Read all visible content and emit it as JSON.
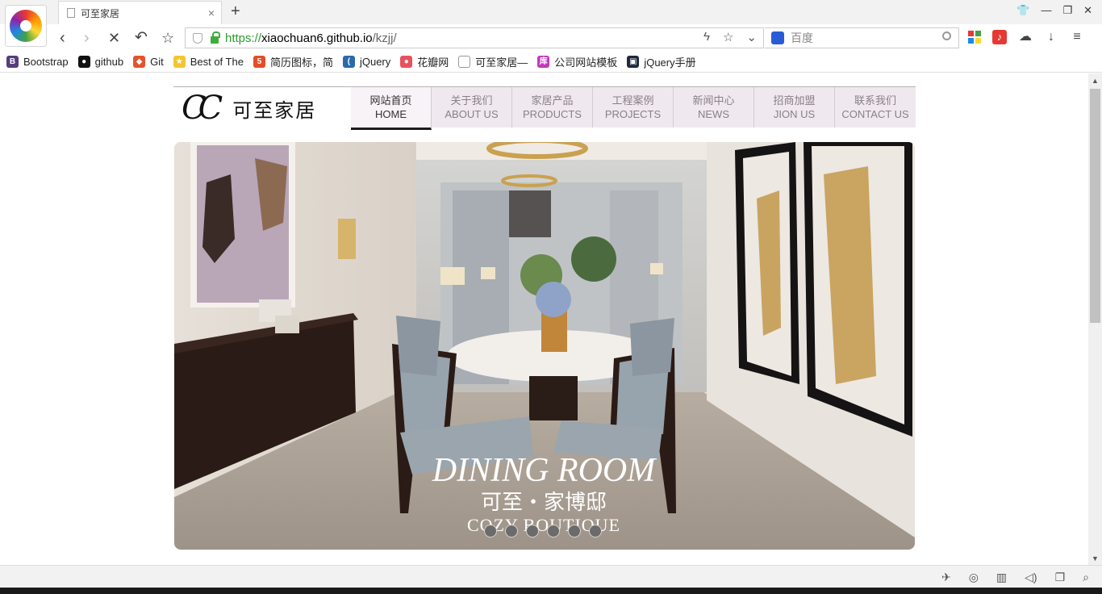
{
  "browser": {
    "tab_title": "可至家居",
    "tab_close": "×",
    "new_tab": "+",
    "url_https": "https://",
    "url_host": "xiaochuan6.github.io",
    "url_path": "/kzjj/",
    "search_placeholder": "百度",
    "bookmarks": [
      {
        "label": "Bootstrap",
        "icon": "bootstrap-icon",
        "color": "#563d7c",
        "glyph": "B"
      },
      {
        "label": "github",
        "icon": "github-icon",
        "color": "#111111",
        "glyph": "●"
      },
      {
        "label": "Git",
        "icon": "git-icon",
        "color": "#e4532d",
        "glyph": "◆"
      },
      {
        "label": "Best of The",
        "icon": "star-folder-icon",
        "color": "#f4c52f",
        "glyph": "★"
      },
      {
        "label": "简历图标，简",
        "icon": "html5-icon",
        "color": "#e44d26",
        "glyph": "5"
      },
      {
        "label": "jQuery",
        "icon": "jquery-icon",
        "color": "#2b6aa8",
        "glyph": "("
      },
      {
        "label": "花瓣网",
        "icon": "huaban-icon",
        "color": "#e8515c",
        "glyph": "●"
      },
      {
        "label": "可至家居—",
        "icon": "page-icon",
        "color": "#ffffff",
        "glyph": ""
      },
      {
        "label": "公司网站模板",
        "icon": "ku-icon",
        "color": "#c03ab8",
        "glyph": "库"
      },
      {
        "label": "jQuery手册",
        "icon": "jquery-book-icon",
        "color": "#1d2a3a",
        "glyph": "▣"
      }
    ]
  },
  "site": {
    "logo_mark": "CC",
    "logo_name": "可至家居",
    "menu": [
      {
        "cn": "网站首页",
        "en": "HOME",
        "active": true
      },
      {
        "cn": "关于我们",
        "en": "ABOUT US",
        "active": false
      },
      {
        "cn": "家居产品",
        "en": "PRODUCTS",
        "active": false
      },
      {
        "cn": "工程案例",
        "en": "PROJECTS",
        "active": false
      },
      {
        "cn": "新闻中心",
        "en": "NEWS",
        "active": false
      },
      {
        "cn": "招商加盟",
        "en": "JION US",
        "active": false
      },
      {
        "cn": "联系我们",
        "en": "CONTACT US",
        "active": false
      }
    ],
    "banner": {
      "headline": "DINING ROOM",
      "subtitle_cn": "可至・家博邸",
      "subtitle_en": "COZY BOUTIQUE",
      "slide_count": 6
    }
  }
}
